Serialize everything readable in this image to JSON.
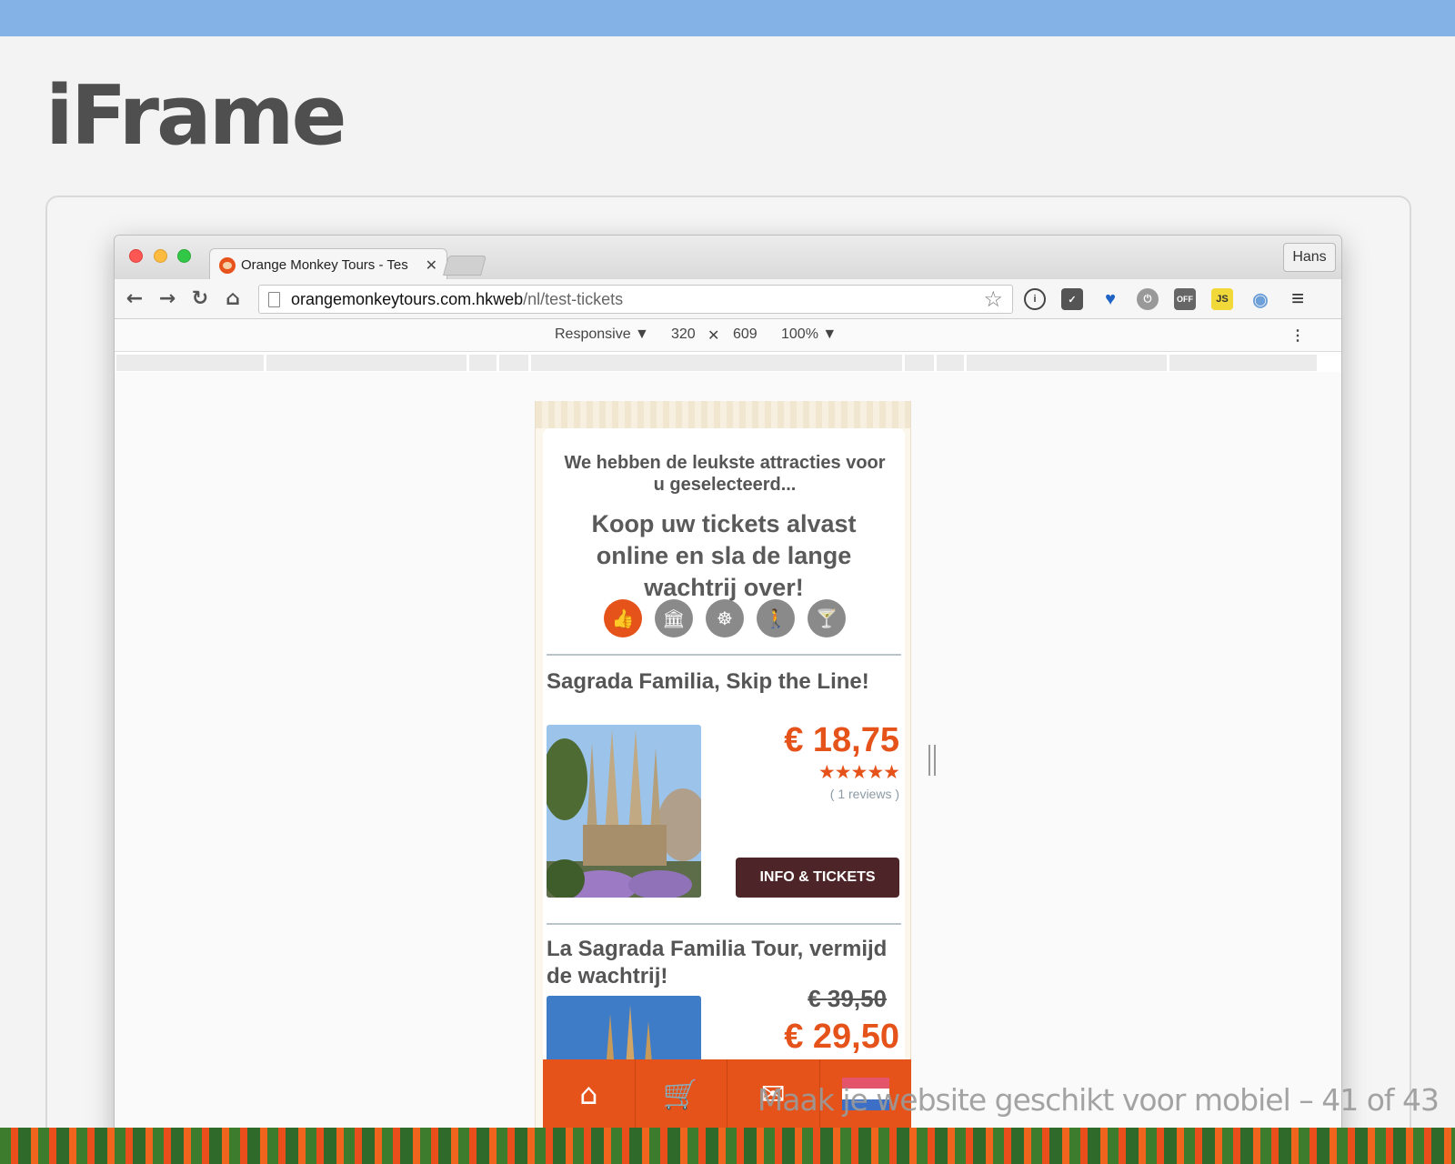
{
  "slide": {
    "title": "iFrame",
    "footer": "Maak je website geschikt voor mobiel – 41 of 43"
  },
  "browser": {
    "tab_title": "Orange Monkey Tours - Tes",
    "tab_close": "✕",
    "profile": "Hans",
    "url_host": "orangemonkeytours.com.hkweb",
    "url_path": "/nl/test-tickets",
    "nav": {
      "back": "←",
      "forward": "→",
      "reload": "↻",
      "home": "⌂"
    },
    "extensions": {
      "info": "i",
      "off": "OFF",
      "js": "JS",
      "menu": "≡"
    }
  },
  "devtools": {
    "device": "Responsive ▼",
    "width": "320",
    "times": "✕",
    "height": "609",
    "zoom": "100% ▼",
    "more": "⋮"
  },
  "page": {
    "lead1": "We hebben de leukste attracties voor u geselecteerd...",
    "lead2": "Koop uw tickets alvast online en sla de lange wachtrij over!",
    "categories": [
      "👍",
      "🏛",
      "☸",
      "🚶",
      "🍸"
    ],
    "product1": {
      "title": "Sagrada Familia, Skip the Line!",
      "price": "€ 18,75",
      "stars": "★★★★★",
      "reviews": "( 1 reviews )",
      "button": "INFO & TICKETS"
    },
    "product2": {
      "title": "La Sagrada Familia Tour, vermijd de wachtrij!",
      "old_price": "€ 39,50",
      "price": "€ 29,50"
    }
  },
  "bottom_nav": {
    "home": "⌂",
    "cart": "🛒",
    "mail": "✉"
  },
  "colors": {
    "accent": "#e5531a",
    "button": "#4d2528",
    "topbar": "#84b1e6"
  }
}
